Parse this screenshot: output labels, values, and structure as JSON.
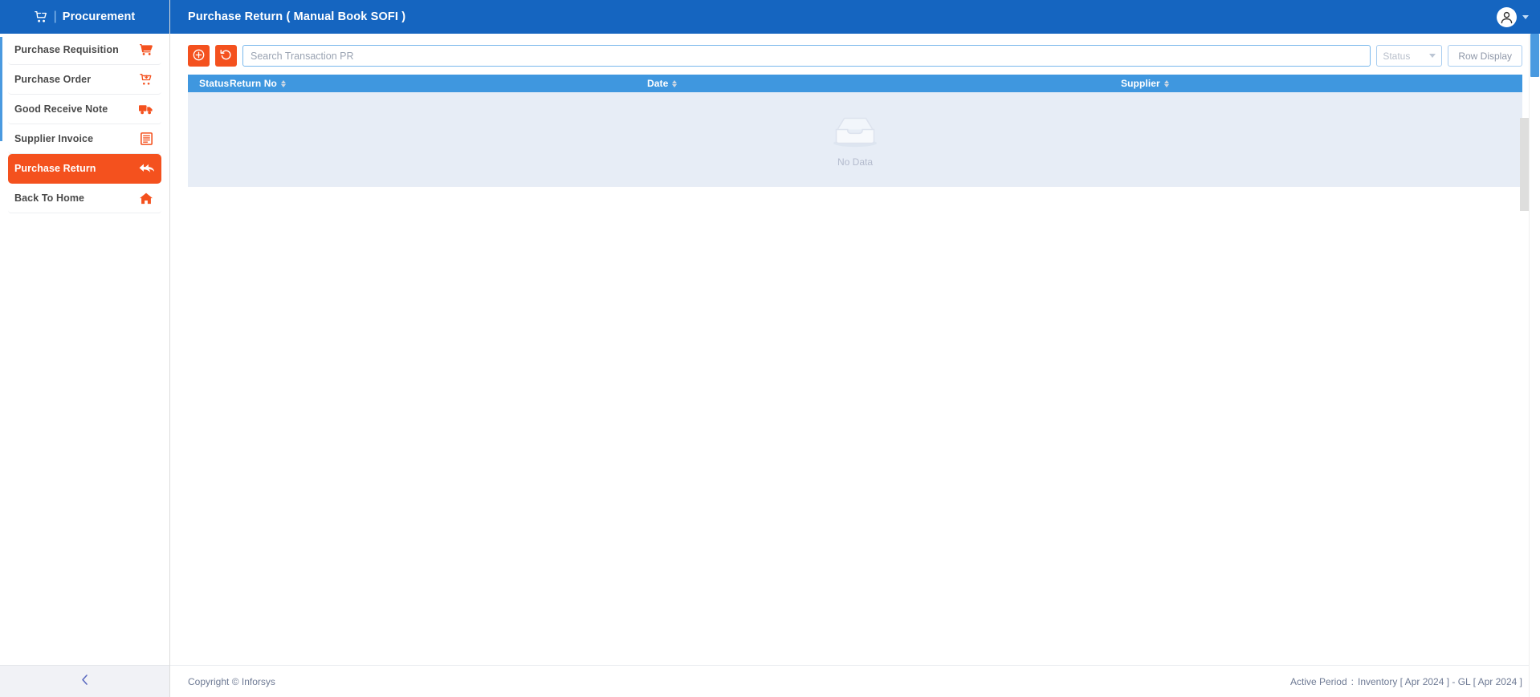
{
  "brand": {
    "icon": "cart-plus-icon",
    "separator": "|",
    "text": "Procurement",
    "header_color": "#1565C0"
  },
  "sidebar": {
    "items": [
      {
        "label": "Purchase Requisition",
        "icon": "shopping-cart-icon",
        "active": false
      },
      {
        "label": "Purchase Order",
        "icon": "cart-arrow-icon",
        "active": false
      },
      {
        "label": "Good Receive Note",
        "icon": "truck-icon",
        "active": false
      },
      {
        "label": "Supplier Invoice",
        "icon": "invoice-document-icon",
        "active": false
      },
      {
        "label": "Purchase Return",
        "icon": "reply-all-icon",
        "active": true
      },
      {
        "label": "Back To Home",
        "icon": "home-icon",
        "active": false
      }
    ],
    "collapse_icon": "chevron-left-icon",
    "active_color": "#F4511E"
  },
  "topbar": {
    "title": "Purchase Return ( Manual Book SOFI )",
    "user_icon": "user-circle-icon",
    "dropdown_icon": "caret-down-icon"
  },
  "toolbar": {
    "add_icon": "plus-circle-icon",
    "refresh_icon": "undo-rotate-icon",
    "search": {
      "placeholder": "Search Transaction PR",
      "value": ""
    },
    "status_filter": {
      "label": "Status",
      "icon": "chevron-down-icon",
      "options": []
    },
    "row_display_label": "Row Display"
  },
  "table": {
    "columns": [
      {
        "label": "Status",
        "sortable": false
      },
      {
        "label": "Return No",
        "sortable": true
      },
      {
        "label": "Date",
        "sortable": true
      },
      {
        "label": "Supplier",
        "sortable": true
      }
    ],
    "rows": [],
    "empty_state": {
      "icon": "empty-inbox-icon",
      "label": "No Data"
    },
    "header_color": "#3F97DF",
    "body_color": "#E7EDF6"
  },
  "footer": {
    "copyright": "Copyright © Inforsys",
    "active_period_label": "Active Period",
    "active_period_separator": ":",
    "active_period_value": "Inventory [ Apr 2024 ]  -  GL [ Apr 2024 ]"
  }
}
